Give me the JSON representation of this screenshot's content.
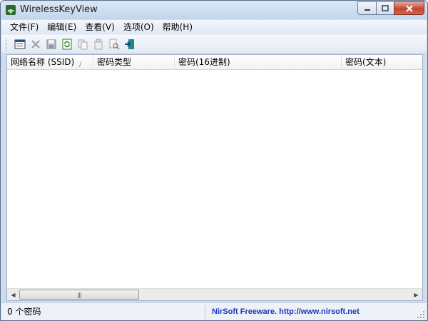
{
  "window": {
    "title": "WirelessKeyView"
  },
  "menu": {
    "items": [
      "文件(F)",
      "编辑(E)",
      "查看(V)",
      "选项(O)",
      "帮助(H)"
    ]
  },
  "toolbar": {
    "buttons": [
      "properties-icon",
      "delete-icon",
      "save-icon",
      "refresh-icon",
      "copy-icon",
      "copy-key-icon",
      "find-icon",
      "exit-icon"
    ]
  },
  "list": {
    "columns": [
      "网络名称 (SSID)",
      "密码类型",
      "密码(16进制)",
      "密码(文本)"
    ],
    "rows": []
  },
  "status": {
    "count_text": "0 个密码",
    "credit_text": "NirSoft Freeware.  http://www.nirsoft.net"
  },
  "colors": {
    "title_bg": "#c2d5ec",
    "close_button": "#c6462f",
    "credit_link": "#1b3ab8"
  }
}
